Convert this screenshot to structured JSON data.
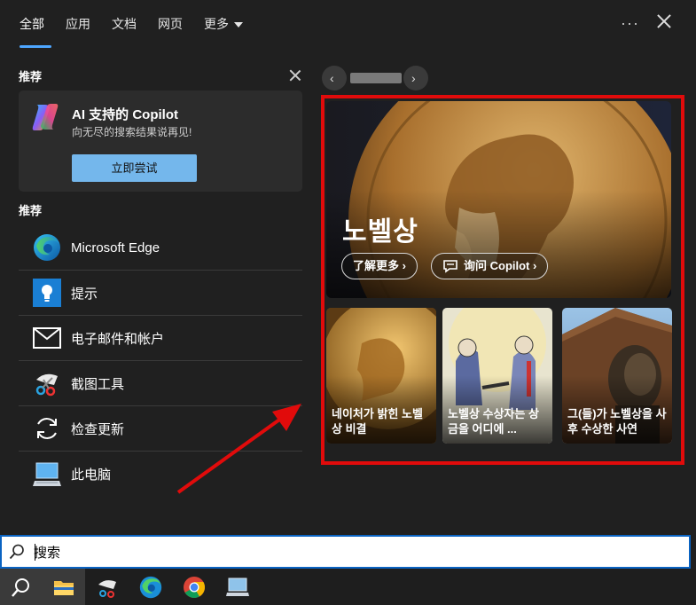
{
  "tabs": [
    {
      "label": "全部",
      "active": true
    },
    {
      "label": "应用"
    },
    {
      "label": "文档"
    },
    {
      "label": "网页"
    },
    {
      "label": "更多"
    }
  ],
  "header": {
    "more_dots": "···"
  },
  "recommend": {
    "heading": "推荐",
    "copilot": {
      "title": "AI 支持的 Copilot",
      "subtitle": "向无尽的搜索结果说再见!",
      "button": "立即尝试"
    }
  },
  "recommend2": {
    "heading": "推荐",
    "items": [
      {
        "label": "Microsoft Edge",
        "icon": "edge-icon"
      },
      {
        "label": "提示",
        "icon": "tips-icon"
      },
      {
        "label": "电子邮件和帐户",
        "icon": "mail-icon"
      },
      {
        "label": "截图工具",
        "icon": "snipping-tool-icon"
      },
      {
        "label": "检查更新",
        "icon": "refresh-icon"
      },
      {
        "label": "此电脑",
        "icon": "computer-icon"
      }
    ]
  },
  "hero": {
    "title": "노벨상",
    "learn_more": "了解更多",
    "ask_copilot": "询问 Copilot"
  },
  "cards": [
    {
      "caption": "네이처가 밝힌 노벨상 비결"
    },
    {
      "caption": "노벨상 수상자는 상금을 어디에 ..."
    },
    {
      "caption": "그(들)가 노벨상을 사후 수상한 사연"
    }
  ],
  "search": {
    "placeholder": "搜索",
    "value": "搜索"
  },
  "colors": {
    "accent": "#4ea6ff",
    "highlight": "#e10b0b",
    "button": "#74b7ec"
  }
}
